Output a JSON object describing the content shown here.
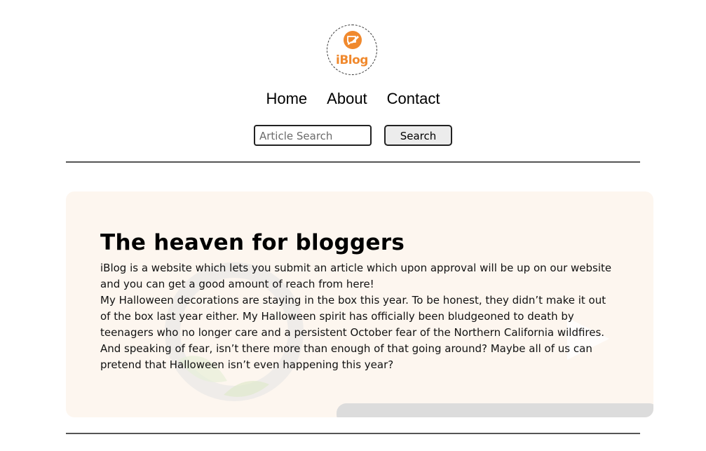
{
  "logo": {
    "text": "iBlog",
    "icon": "speech-bubble-edit-icon",
    "color": "#f0892d"
  },
  "nav": {
    "items": [
      {
        "label": "Home"
      },
      {
        "label": "About"
      },
      {
        "label": "Contact"
      }
    ]
  },
  "search": {
    "placeholder": "Article Search",
    "button_label": "Search"
  },
  "hero": {
    "title": "The heaven for bloggers",
    "paragraph_1": "iBlog is a website which lets you submit an article which upon approval will be up on our website and you can get a good amount of reach from here!",
    "paragraph_2": "My Halloween decorations are staying in the box this year. To be honest, they didn’t make it out of the box last year either. My Halloween spirit has officially been bludgeoned to death by teenagers who no longer care and a persistent October fear of the Northern California wildfires. And speaking of fear, isn’t there more than enough of that going around? Maybe all of us can pretend that Halloween isn’t even happening this year?",
    "background_color": "#fdf6ef"
  }
}
